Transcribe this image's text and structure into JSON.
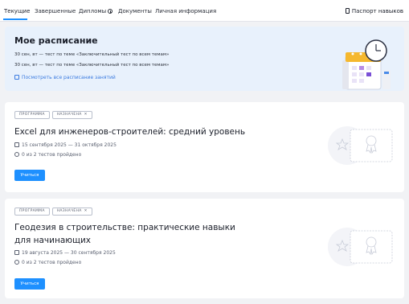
{
  "tabs": [
    {
      "label": "Текущие"
    },
    {
      "label": "Завершенные"
    },
    {
      "label": "Дипломы"
    },
    {
      "label": "Документы"
    },
    {
      "label": "Личная информация"
    }
  ],
  "passport_label": "Паспорт навыков",
  "schedule": {
    "title": "Мое расписание",
    "lines": [
      "30 сен, вт  —  тест по теме  «Заключительный тест по всем темам»",
      "30 сен, вт  —  тест по теме  «Заключительный тест по всем темам»"
    ],
    "link": "Посмотреть все расписание занятий"
  },
  "courses": [
    {
      "badges": [
        "ПРОГРАММА",
        "НАЗНАЧЕНА"
      ],
      "title": "Excel для инженеров-строителей: средний уровень",
      "dates": "15 сентября 2025 — 31 октября 2025",
      "progress": "0 из 2 тестов пройдено",
      "button": "Учиться"
    },
    {
      "badges": [
        "ПРОГРАММА",
        "НАЗНАЧЕНА"
      ],
      "title": "Геодезия в строительстве: практические навыки для начинающих",
      "dates": "19 августа 2025 — 30 сентября 2025",
      "progress": "0 из 2 тестов пройдено",
      "button": "Учиться"
    }
  ],
  "colors": {
    "accent": "#1e90ff",
    "schedule_bg": "#e8f1fc",
    "link": "#3b7be0"
  }
}
